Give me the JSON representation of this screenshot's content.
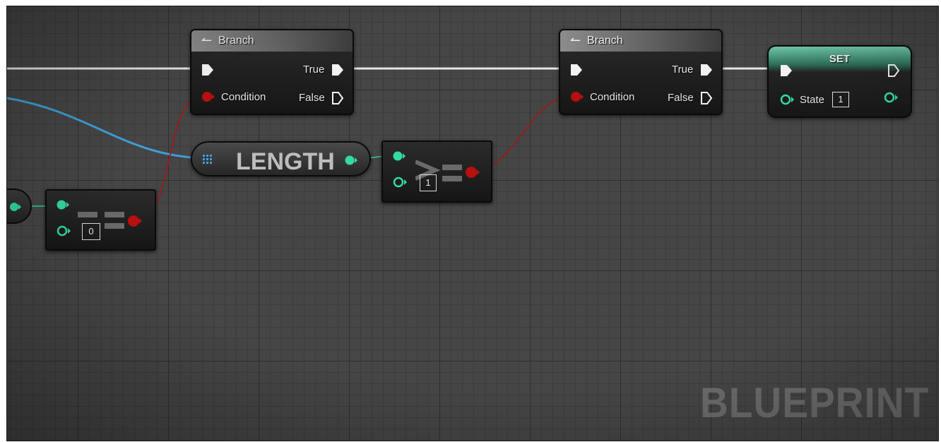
{
  "graph": {
    "watermark": "BLUEPRINT",
    "colors": {
      "exec_wire": "#e8e8e8",
      "bool_wire": "#9b1b1b",
      "int_wire": "#2fd4a0",
      "array_wire": "#3f9fd8",
      "bool_pin": "#b80f0f",
      "int_pin": "#34d9a6"
    }
  },
  "nodes": {
    "branch1": {
      "title": "Branch",
      "pins": {
        "condition": "Condition",
        "true": "True",
        "false": "False"
      }
    },
    "branch2": {
      "title": "Branch",
      "pins": {
        "condition": "Condition",
        "true": "True",
        "false": "False"
      }
    },
    "set": {
      "title": "SET",
      "var_label": "State",
      "var_value": "1"
    },
    "length": {
      "title": "LENGTH"
    },
    "equal": {
      "operand": "0"
    },
    "greater": {
      "operand": "1"
    }
  }
}
